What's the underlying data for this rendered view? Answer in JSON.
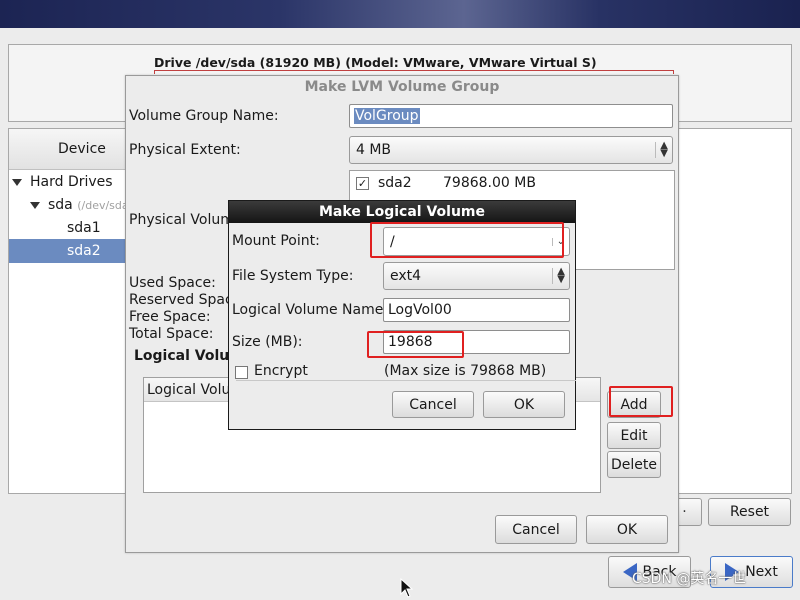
{
  "background": {
    "drive_title": "Drive /dev/sda (81920 MB) (Model: VMware, VMware Virtual S)",
    "tree": {
      "header": "Device",
      "items": [
        {
          "label": "Hard Drives"
        },
        {
          "label": "sda",
          "detail": "(/dev/sda"
        },
        {
          "label": "sda1"
        },
        {
          "label": "sda2"
        }
      ]
    },
    "buttons": {
      "reset": "Reset",
      "back": "Back",
      "next": "Next"
    },
    "watermark": "CSDN @英名一世"
  },
  "lvm_dialog": {
    "title": "Make LVM Volume Group",
    "vg_name_label": "Volume Group Name:",
    "vg_name_value": "VolGroup",
    "pe_label": "Physical Extent:",
    "pe_value": "4 MB",
    "pv_label": "Physical Volum",
    "pv_items": [
      {
        "name": "sda2",
        "size": "79868.00 MB",
        "checked": true
      }
    ],
    "stats": {
      "used": "Used Space:",
      "reserved": "Reserved Space",
      "free": "Free Space:",
      "total": "Total Space:"
    },
    "lv_section_label": "Logical Volu",
    "lv_table_header": "Logical Volu",
    "buttons": {
      "add": "Add",
      "edit": "Edit",
      "delete": "Delete",
      "cancel": "Cancel",
      "ok": "OK"
    }
  },
  "lv_dialog": {
    "title": "Make Logical Volume",
    "mount_point_label": "Mount Point:",
    "mount_point_value": "/",
    "fs_type_label": "File System Type:",
    "fs_type_value": "ext4",
    "lv_name_label": "Logical Volume Name:",
    "lv_name_value": "LogVol00",
    "size_label": "Size (MB):",
    "size_value": "19868",
    "encrypt_label": "Encrypt",
    "encrypt_checked": false,
    "max_size_text": "(Max size is 79868 MB)",
    "buttons": {
      "cancel": "Cancel",
      "ok": "OK"
    }
  },
  "colors": {
    "selection": "#6b8bc0",
    "annotation_red": "#e02020",
    "titlebar": "#1a1a1a"
  }
}
